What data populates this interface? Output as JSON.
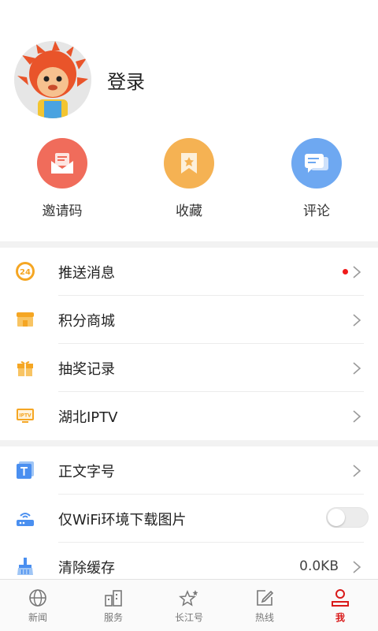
{
  "profile": {
    "login_label": "登录"
  },
  "quick_actions": [
    {
      "label": "邀请码",
      "icon": "envelope-icon",
      "color": "#f06c5b"
    },
    {
      "label": "收藏",
      "icon": "bookmark-icon",
      "color": "#f5b253"
    },
    {
      "label": "评论",
      "icon": "comment-icon",
      "color": "#6ea8f1"
    }
  ],
  "menu_group_1": [
    {
      "label": "推送消息",
      "icon": "push-24-icon",
      "has_dot": true
    },
    {
      "label": "积分商城",
      "icon": "shop-icon"
    },
    {
      "label": "抽奖记录",
      "icon": "gift-icon"
    },
    {
      "label": "湖北IPTV",
      "icon": "iptv-icon"
    }
  ],
  "menu_group_2": [
    {
      "label": "正文字号",
      "icon": "font-size-icon"
    },
    {
      "label": "仅WiFi环境下载图片",
      "icon": "wifi-router-icon",
      "toggle_on": false
    },
    {
      "label": "清除缓存",
      "icon": "broom-icon",
      "value": "0.0KB"
    }
  ],
  "tabbar": [
    {
      "label": "新闻",
      "icon": "globe-icon"
    },
    {
      "label": "服务",
      "icon": "buildings-icon"
    },
    {
      "label": "长江号",
      "icon": "stars-icon"
    },
    {
      "label": "热线",
      "icon": "edit-icon"
    },
    {
      "label": "我",
      "icon": "user-icon",
      "active": true
    }
  ],
  "colors": {
    "accent": "#d91a1a",
    "notification_dot": "#f01a1a"
  }
}
